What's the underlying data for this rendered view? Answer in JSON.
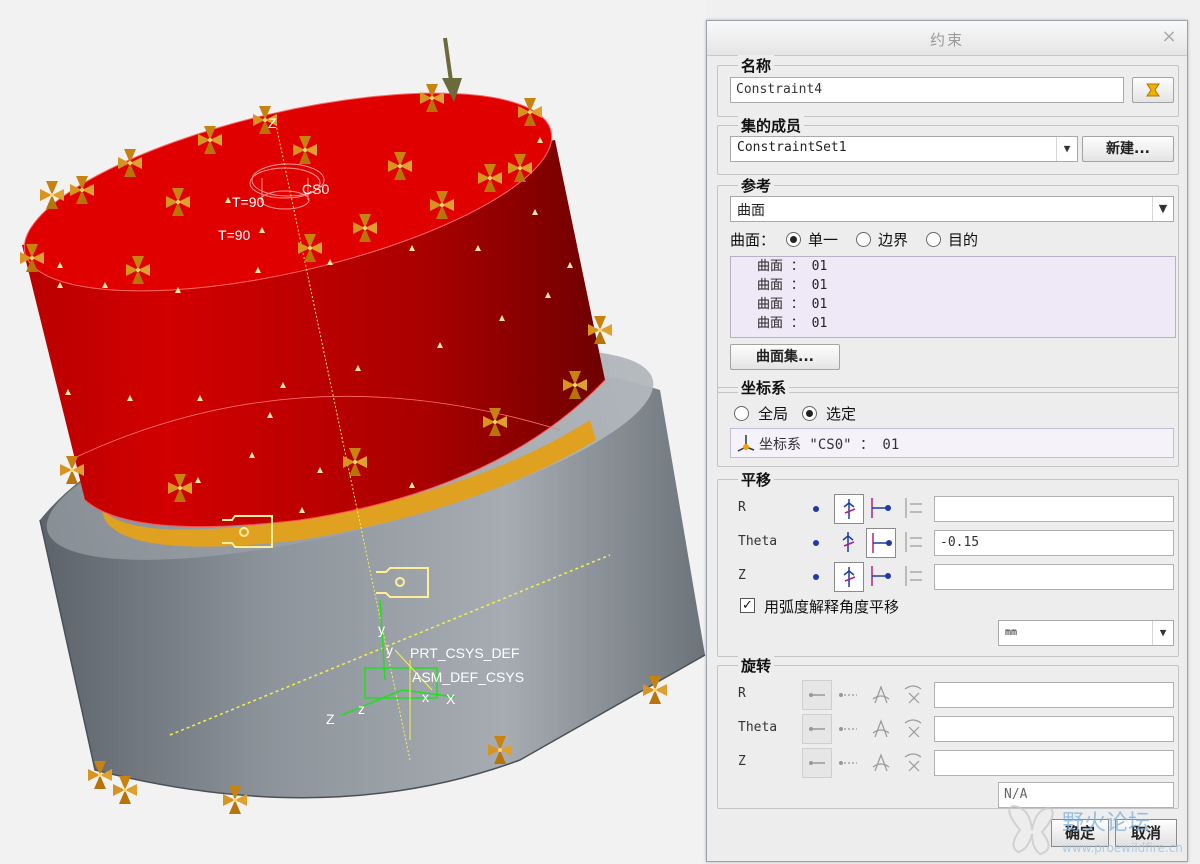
{
  "viewport": {
    "labels": {
      "t90_a": "T=90",
      "t90_b": "T=90",
      "cs0": "CS0",
      "y1": "y",
      "y2": "y",
      "z_axis": "Z",
      "z1": "z",
      "z2": "Z",
      "x1": "x",
      "x2": "X",
      "prt_csys_def": "PRT_CSYS_DEF",
      "overlap": "ASM_DEF_CSYS"
    }
  },
  "dialog": {
    "title": "约束",
    "close_glyph": "×",
    "name": {
      "title": "名称",
      "value": "Constraint4"
    },
    "set": {
      "title": "集的成员",
      "value": "ConstraintSet1",
      "new_button": "新建..."
    },
    "reference": {
      "title": "参考",
      "type_value": "曲面",
      "mode_label": "曲面：",
      "options": [
        "单一",
        "边界",
        "目的"
      ],
      "selected_option": "单一",
      "list_items": [
        "曲面 ： 01",
        "曲面 ： 01",
        "曲面 ： 01",
        "曲面 ： 01"
      ],
      "surface_set_button": "曲面集..."
    },
    "csys": {
      "title": "坐标系",
      "options": [
        "全局",
        "选定"
      ],
      "selected_option": "选定",
      "field_value": "坐标系 \"CS0\" ： 01"
    },
    "translation": {
      "title": "平移",
      "rows": [
        {
          "label": "R",
          "value": ""
        },
        {
          "label": "Theta",
          "value": "-0.15"
        },
        {
          "label": "Z",
          "value": ""
        }
      ],
      "checkbox_label": "用弧度解释角度平移",
      "unit_value": "mm"
    },
    "rotation": {
      "title": "旋转",
      "rows": [
        {
          "label": "R",
          "value": ""
        },
        {
          "label": "Theta",
          "value": ""
        },
        {
          "label": "Z",
          "value": ""
        }
      ],
      "na_value": "N/A"
    },
    "ok_button": "确定",
    "cancel_button": "取消"
  },
  "watermark": {
    "text": "野火论坛",
    "subtext": "www.proewildfire.cn"
  },
  "colors": {
    "cylinder_red": "#c80000",
    "cylinder_top": "#e00000",
    "base_gray": "#7e868e",
    "constraint_orange": "#d08a10",
    "csys_green": "#22dd22",
    "axis_yellow": "#f5f050",
    "list_bg": "#efe8f7"
  }
}
